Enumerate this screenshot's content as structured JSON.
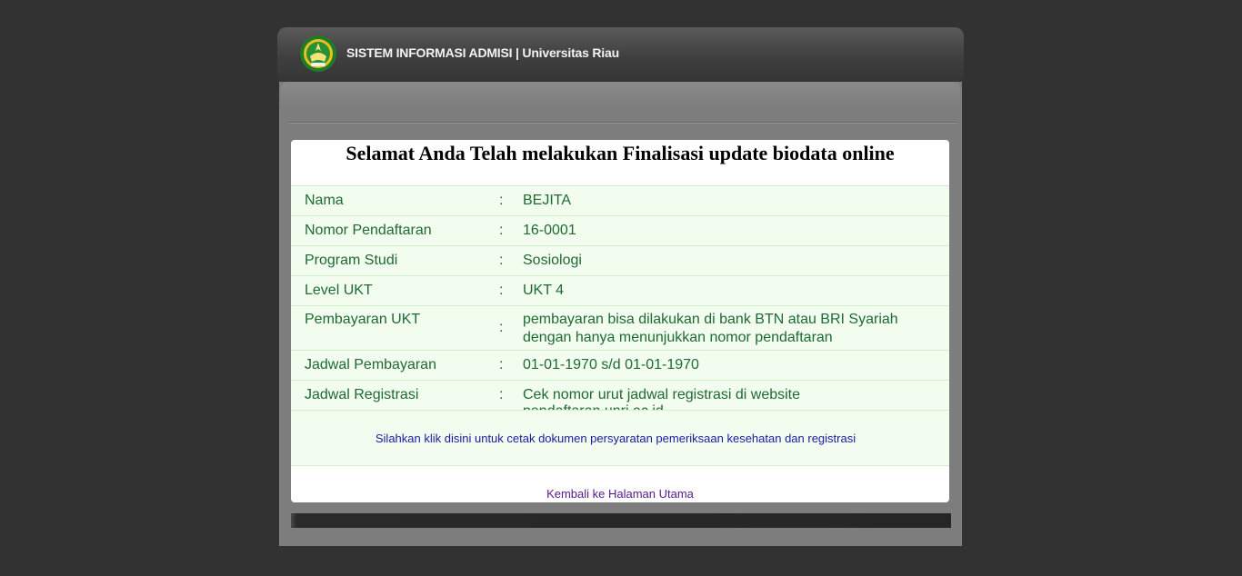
{
  "header": {
    "title": "SISTEM INFORMASI ADMISI | Universitas Riau",
    "logo_icon": "university-crest-icon"
  },
  "card": {
    "title": "Selamat Anda Telah melakukan Finalisasi update biodata online",
    "separator": ":",
    "rows": [
      {
        "label": "Nama",
        "value": "BEJITA"
      },
      {
        "label": "Nomor Pendaftaran",
        "value": "16-0001"
      },
      {
        "label": "Program Studi",
        "value": "Sosiologi"
      },
      {
        "label": "Level UKT",
        "value": "UKT 4"
      },
      {
        "label": "Pembayaran UKT",
        "value_line1": "pembayaran bisa dilakukan di bank BTN atau BRI Syariah",
        "value_line2": "dengan hanya menunjukkan nomor pendaftaran"
      },
      {
        "label": "Jadwal Pembayaran",
        "value": "01-01-1970 s/d 01-01-1970"
      },
      {
        "label": "Jadwal Registrasi",
        "value": "Cek nomor urut jadwal registrasi di website pendaftaran.unri.ac.id"
      }
    ],
    "print_link": "Silahkan klik disini untuk cetak dokumen persyaratan pemeriksaan kesehatan dan registrasi",
    "back_link": "Kembali ke Halaman Utama"
  },
  "colors": {
    "background": "#323232",
    "row_background": "#f2fdf0",
    "row_text": "#1e6a33",
    "link": "#1a1aa0",
    "visited_link": "#551a8b"
  }
}
